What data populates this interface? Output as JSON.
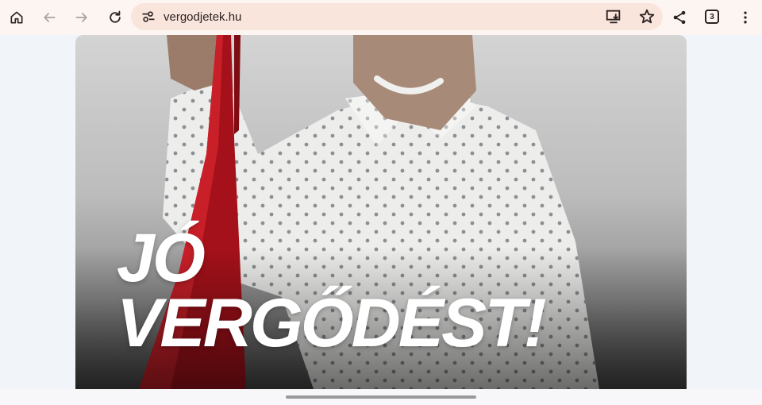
{
  "browser": {
    "url": "vergodjetek.hu",
    "tab_count": "3",
    "icons": {
      "home": "home-icon",
      "back": "back-arrow-icon",
      "forward": "forward-arrow-icon",
      "reload": "reload-icon",
      "site_settings": "tune-icon",
      "install": "install-app-icon",
      "bookmark": "star-icon",
      "share": "share-icon",
      "menu": "more-vert-icon"
    }
  },
  "hero": {
    "headline_line1": "JÓ",
    "headline_line2": "VERGŐDÉST!"
  },
  "colors": {
    "toolbar_bg": "#fdf5f1",
    "omnibox_bg": "#f9e5dc",
    "page_bg": "#f1f4f9",
    "bag_red": "#b5121b"
  }
}
